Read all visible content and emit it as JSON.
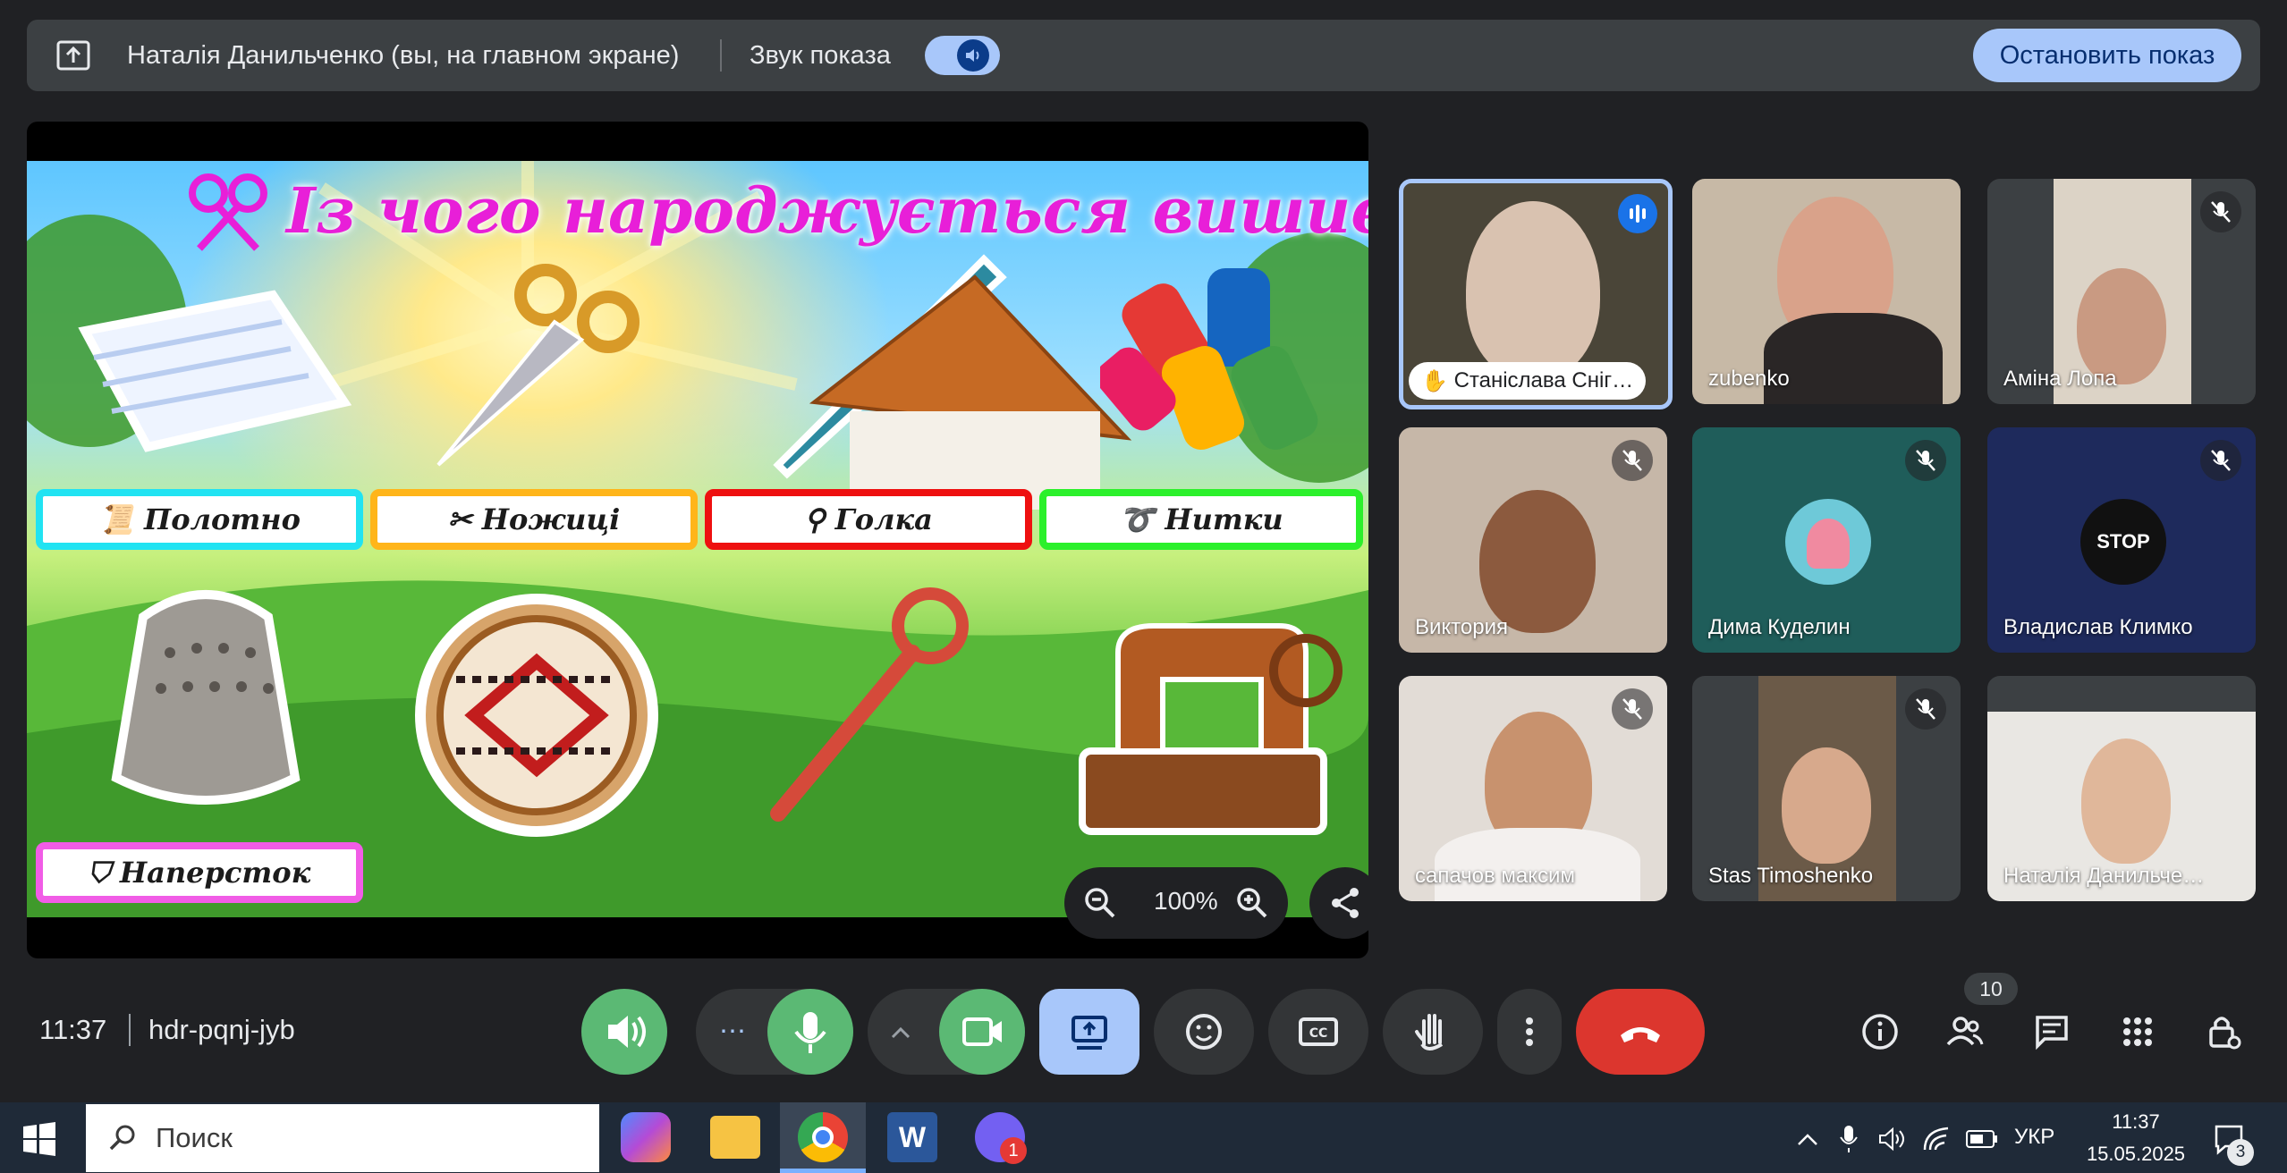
{
  "banner": {
    "presenter_text": "Наталія Данильченко (вы, на главном экране)",
    "sound_label": "Звук показа",
    "stop_button": "Остановить показ"
  },
  "slide": {
    "title": "Із чого народжується вишивка?",
    "labels": [
      "Полотно",
      "Ножиці",
      "Голка",
      "Нитки",
      "Наперсток"
    ],
    "zoom_level": "100%"
  },
  "participants": [
    {
      "name": "Станіслава Сніг…",
      "state": "speaking"
    },
    {
      "name": "zubenko",
      "state": "none"
    },
    {
      "name": "Аміна Лопа",
      "state": "muted"
    },
    {
      "name": "Виктория",
      "state": "muted"
    },
    {
      "name": "Дима Куделин",
      "state": "muted"
    },
    {
      "name": "Владислав Климко",
      "state": "muted"
    },
    {
      "name": "сапачов максим",
      "state": "muted"
    },
    {
      "name": "Stas Timoshenko",
      "state": "muted"
    },
    {
      "name": "Наталія Данильче…",
      "state": "none"
    }
  ],
  "avatar_text": "STOP",
  "meeting": {
    "time": "11:37",
    "code": "hdr-pqnj-jyb",
    "participant_count": "10"
  },
  "taskbar": {
    "search_placeholder": "Поиск",
    "viber_badge": "1",
    "language": "УКР",
    "time": "11:37",
    "date": "15.05.2025",
    "notification_count": "3"
  },
  "colors": {
    "accent": "#a8c7fa",
    "green": "#5bb974",
    "end_call": "#dc362e",
    "title_magenta": "#e81fd8"
  }
}
